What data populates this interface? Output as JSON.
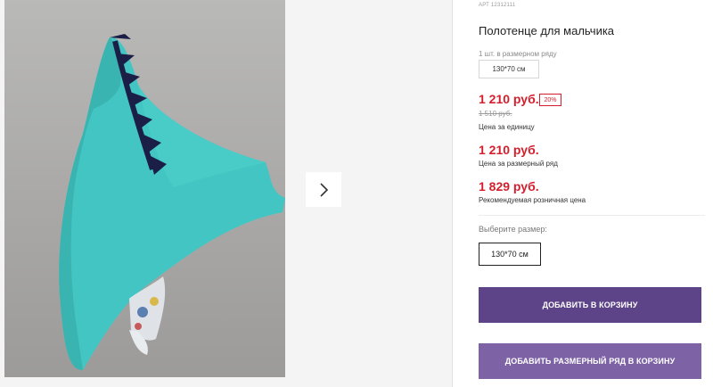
{
  "product": {
    "article": "АРТ 12312111",
    "title": "Полотенце для мальчика",
    "row_count": "1 шт. в размерном ряду",
    "row_size": "130*70 см"
  },
  "prices": {
    "unit_price": "1 210 руб.",
    "discount": "20%",
    "old_price": "1 510 руб.",
    "unit_label": "Цена за единицу",
    "row_price": "1 210 руб.",
    "row_label": "Цена за размерный ряд",
    "retail_price": "1 829 руб.",
    "retail_label": "Рекомендуемая розничная цена"
  },
  "size": {
    "prompt": "Выберите размер:",
    "selected": "130*70 см"
  },
  "actions": {
    "add_to_cart": "ДОБАВИТЬ В КОРЗИНУ",
    "add_row_to_cart": "ДОБАВИТЬ РАЗМЕРНЫЙ РЯД В КОРЗИНУ"
  },
  "gallery": {
    "next_icon": "chevron-right-icon"
  },
  "colors": {
    "price_red": "#d51e2c",
    "button_primary": "#5d4488",
    "button_secondary": "#7d63a6",
    "towel_teal": "#43c6c3",
    "spikes_navy": "#1b1f47"
  }
}
